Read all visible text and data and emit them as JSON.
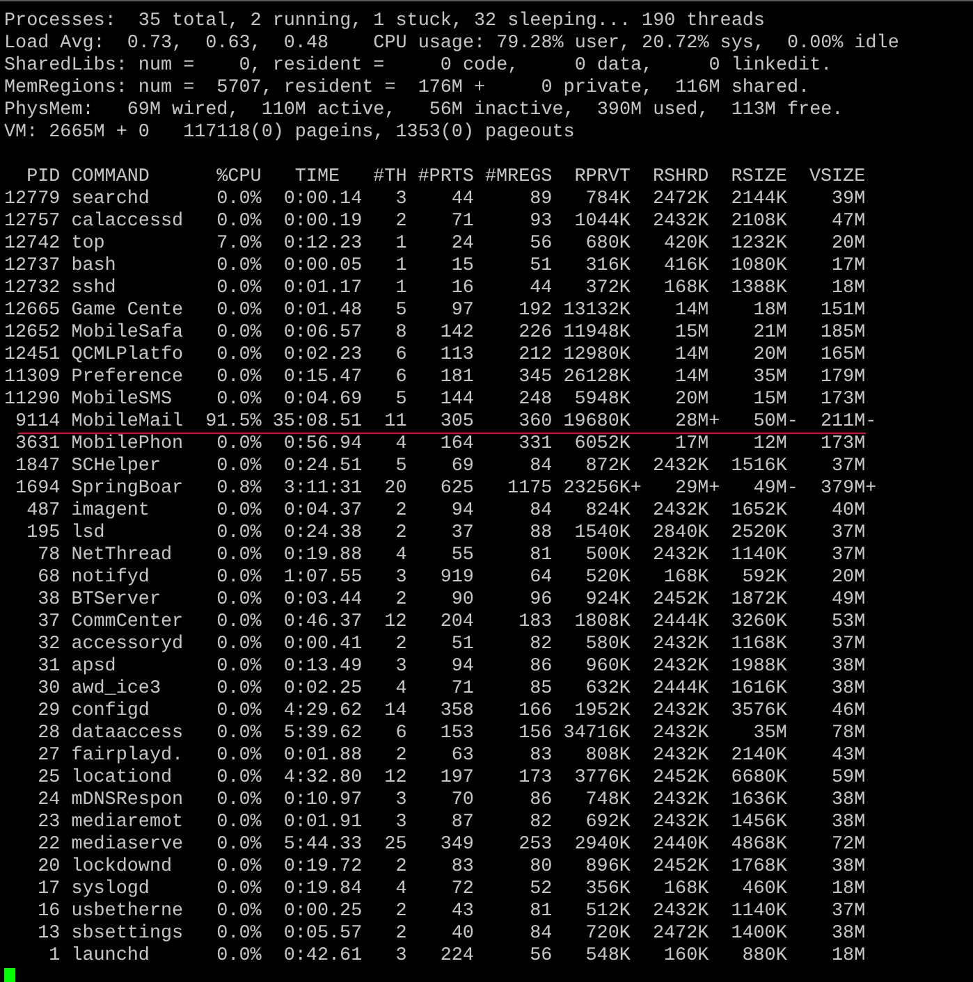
{
  "summary": [
    "Processes:  35 total, 2 running, 1 stuck, 32 sleeping... 190 threads",
    "Load Avg:  0.73,  0.63,  0.48    CPU usage: 79.28% user, 20.72% sys,  0.00% idle",
    "SharedLibs: num =    0, resident =     0 code,     0 data,     0 linkedit.",
    "MemRegions: num =  5707, resident =  176M +     0 private,  116M shared.",
    "PhysMem:   69M wired,  110M active,   56M inactive,  390M used,  113M free.",
    "VM: 2665M + 0   117118(0) pageins, 1353(0) pageouts"
  ],
  "table": {
    "columns": [
      "PID",
      "COMMAND",
      "%CPU",
      "TIME",
      "#TH",
      "#PRTS",
      "#MREGS",
      "RPRVT",
      "RSHRD",
      "RSIZE",
      "VSIZE"
    ],
    "rows": [
      {
        "underlined": false,
        "cells": [
          "12779",
          "searchd",
          "0.0%",
          "0:00.14",
          "3",
          "44",
          "89",
          "784K",
          "2472K",
          "2144K",
          "39M"
        ]
      },
      {
        "underlined": false,
        "cells": [
          "12757",
          "calaccessd",
          "0.0%",
          "0:00.19",
          "2",
          "71",
          "93",
          "1044K",
          "2432K",
          "2108K",
          "47M"
        ]
      },
      {
        "underlined": false,
        "cells": [
          "12742",
          "top",
          "7.0%",
          "0:12.23",
          "1",
          "24",
          "56",
          "680K",
          "420K",
          "1232K",
          "20M"
        ]
      },
      {
        "underlined": false,
        "cells": [
          "12737",
          "bash",
          "0.0%",
          "0:00.05",
          "1",
          "15",
          "51",
          "316K",
          "416K",
          "1080K",
          "17M"
        ]
      },
      {
        "underlined": false,
        "cells": [
          "12732",
          "sshd",
          "0.0%",
          "0:01.17",
          "1",
          "16",
          "44",
          "372K",
          "168K",
          "1388K",
          "18M"
        ]
      },
      {
        "underlined": false,
        "cells": [
          "12665",
          "Game Cente",
          "0.0%",
          "0:01.48",
          "5",
          "97",
          "192",
          "13132K",
          "14M",
          "18M",
          "151M"
        ]
      },
      {
        "underlined": false,
        "cells": [
          "12652",
          "MobileSafa",
          "0.0%",
          "0:06.57",
          "8",
          "142",
          "226",
          "11948K",
          "15M",
          "21M",
          "185M"
        ]
      },
      {
        "underlined": false,
        "cells": [
          "12451",
          "QCMLPlatfo",
          "0.0%",
          "0:02.23",
          "6",
          "113",
          "212",
          "12980K",
          "14M",
          "20M",
          "165M"
        ]
      },
      {
        "underlined": false,
        "cells": [
          "11309",
          "Preference",
          "0.0%",
          "0:15.47",
          "6",
          "181",
          "345",
          "26128K",
          "14M",
          "35M",
          "179M"
        ]
      },
      {
        "underlined": false,
        "cells": [
          "11290",
          "MobileSMS",
          "0.0%",
          "0:04.69",
          "5",
          "144",
          "248",
          "5948K",
          "20M",
          "15M",
          "173M"
        ]
      },
      {
        "underlined": true,
        "cells": [
          "9114",
          "MobileMail",
          "91.5%",
          "35:08.51",
          "11",
          "305",
          "360",
          "19680K",
          {
            "value": "28M",
            "change": "+"
          },
          {
            "value": "50M",
            "change": "-"
          },
          {
            "value": "211M",
            "change": "-"
          }
        ]
      },
      {
        "underlined": false,
        "cells": [
          "3631",
          "MobilePhon",
          "0.0%",
          "0:56.94",
          "4",
          "164",
          "331",
          "6052K",
          "17M",
          "12M",
          "173M"
        ]
      },
      {
        "underlined": false,
        "cells": [
          "1847",
          "SCHelper",
          "0.0%",
          "0:24.51",
          "5",
          "69",
          "84",
          "872K",
          "2432K",
          "1516K",
          "37M"
        ]
      },
      {
        "underlined": false,
        "cells": [
          "1694",
          "SpringBoar",
          "0.8%",
          "3:11:31",
          "20",
          "625",
          "1175",
          {
            "value": "23256K",
            "change": "+"
          },
          {
            "value": "29M",
            "change": "+"
          },
          {
            "value": "49M",
            "change": "-"
          },
          {
            "value": "379M",
            "change": "+"
          }
        ]
      },
      {
        "underlined": false,
        "cells": [
          "487",
          "imagent",
          "0.0%",
          "0:04.37",
          "2",
          "94",
          "84",
          "824K",
          "2432K",
          "1652K",
          "40M"
        ]
      },
      {
        "underlined": false,
        "cells": [
          "195",
          "lsd",
          "0.0%",
          "0:24.38",
          "2",
          "37",
          "88",
          "1540K",
          "2840K",
          "2520K",
          "37M"
        ]
      },
      {
        "underlined": false,
        "cells": [
          "78",
          "NetThread",
          "0.0%",
          "0:19.88",
          "4",
          "55",
          "81",
          "500K",
          "2432K",
          "1140K",
          "37M"
        ]
      },
      {
        "underlined": false,
        "cells": [
          "68",
          "notifyd",
          "0.0%",
          "1:07.55",
          "3",
          "919",
          "64",
          "520K",
          "168K",
          "592K",
          "20M"
        ]
      },
      {
        "underlined": false,
        "cells": [
          "38",
          "BTServer",
          "0.0%",
          "0:03.44",
          "2",
          "90",
          "96",
          "924K",
          "2452K",
          "1872K",
          "49M"
        ]
      },
      {
        "underlined": false,
        "cells": [
          "37",
          "CommCenter",
          "0.0%",
          "0:46.37",
          "12",
          "204",
          "183",
          "1808K",
          "2444K",
          "3260K",
          "53M"
        ]
      },
      {
        "underlined": false,
        "cells": [
          "32",
          "accessoryd",
          "0.0%",
          "0:00.41",
          "2",
          "51",
          "82",
          "580K",
          "2432K",
          "1168K",
          "37M"
        ]
      },
      {
        "underlined": false,
        "cells": [
          "31",
          "apsd",
          "0.0%",
          "0:13.49",
          "3",
          "94",
          "86",
          "960K",
          "2432K",
          "1988K",
          "38M"
        ]
      },
      {
        "underlined": false,
        "cells": [
          "30",
          "awd_ice3",
          "0.0%",
          "0:02.25",
          "4",
          "71",
          "85",
          "632K",
          "2444K",
          "1616K",
          "38M"
        ]
      },
      {
        "underlined": false,
        "cells": [
          "29",
          "configd",
          "0.0%",
          "4:29.62",
          "14",
          "358",
          "166",
          "1952K",
          "2432K",
          "3576K",
          "46M"
        ]
      },
      {
        "underlined": false,
        "cells": [
          "28",
          "dataaccess",
          "0.0%",
          "5:39.62",
          "6",
          "153",
          "156",
          "34716K",
          "2432K",
          "35M",
          "78M"
        ]
      },
      {
        "underlined": false,
        "cells": [
          "27",
          "fairplayd.",
          "0.0%",
          "0:01.88",
          "2",
          "63",
          "83",
          "808K",
          "2432K",
          "2140K",
          "43M"
        ]
      },
      {
        "underlined": false,
        "cells": [
          "25",
          "locationd",
          "0.0%",
          "4:32.80",
          "12",
          "197",
          "173",
          "3776K",
          "2452K",
          "6680K",
          "59M"
        ]
      },
      {
        "underlined": false,
        "cells": [
          "24",
          "mDNSRespon",
          "0.0%",
          "0:10.97",
          "3",
          "70",
          "86",
          "748K",
          "2432K",
          "1636K",
          "38M"
        ]
      },
      {
        "underlined": false,
        "cells": [
          "23",
          "mediaremot",
          "0.0%",
          "0:01.91",
          "3",
          "87",
          "82",
          "692K",
          "2432K",
          "1456K",
          "38M"
        ]
      },
      {
        "underlined": false,
        "cells": [
          "22",
          "mediaserve",
          "0.0%",
          "5:44.33",
          "25",
          "349",
          "253",
          "2940K",
          "2440K",
          "4868K",
          "72M"
        ]
      },
      {
        "underlined": false,
        "cells": [
          "20",
          "lockdownd",
          "0.0%",
          "0:19.72",
          "2",
          "83",
          "80",
          "896K",
          "2452K",
          "1768K",
          "38M"
        ]
      },
      {
        "underlined": false,
        "cells": [
          "17",
          "syslogd",
          "0.0%",
          "0:19.84",
          "4",
          "72",
          "52",
          "356K",
          "168K",
          "460K",
          "18M"
        ]
      },
      {
        "underlined": false,
        "cells": [
          "16",
          "usbetherne",
          "0.0%",
          "0:00.25",
          "2",
          "43",
          "81",
          "512K",
          "2432K",
          "1140K",
          "37M"
        ]
      },
      {
        "underlined": false,
        "cells": [
          "13",
          "sbsettings",
          "0.0%",
          "0:05.57",
          "2",
          "40",
          "84",
          "720K",
          "2472K",
          "1400K",
          "38M"
        ]
      },
      {
        "underlined": false,
        "cells": [
          "1",
          "launchd",
          "0.0%",
          "0:42.61",
          "3",
          "224",
          "56",
          "548K",
          "160K",
          "880K",
          "18M"
        ]
      }
    ]
  }
}
